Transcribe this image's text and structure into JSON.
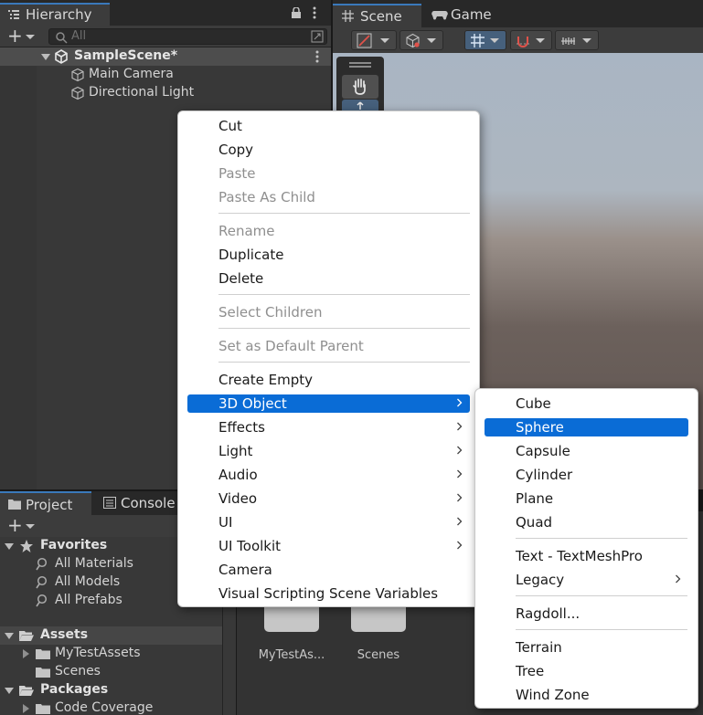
{
  "hierarchy": {
    "tab_label": "Hierarchy",
    "search_placeholder": "All",
    "scene_name": "SampleScene*",
    "objects": [
      "Main Camera",
      "Directional Light"
    ]
  },
  "scene_view": {
    "tabs": [
      {
        "label": "Scene",
        "icon": "grid-hash-icon"
      },
      {
        "label": "Game",
        "icon": "gamepad-icon"
      }
    ]
  },
  "project": {
    "tabs": [
      {
        "label": "Project",
        "icon": "folder-icon"
      },
      {
        "label": "Console",
        "icon": "console-icon"
      }
    ],
    "favorites": {
      "label": "Favorites",
      "items": [
        "All Materials",
        "All Models",
        "All Prefabs"
      ]
    },
    "assets": {
      "label": "Assets",
      "items": [
        "MyTestAssets",
        "Scenes"
      ]
    },
    "packages": {
      "label": "Packages",
      "items": [
        "Code Coverage"
      ]
    },
    "grid_items": [
      "MyTestAs...",
      "Scenes"
    ]
  },
  "context_menu": {
    "items": {
      "cut": "Cut",
      "copy": "Copy",
      "paste": "Paste",
      "paste_as_child": "Paste As Child",
      "rename": "Rename",
      "duplicate": "Duplicate",
      "delete": "Delete",
      "select_children": "Select Children",
      "set_default_parent": "Set as Default Parent",
      "create_empty": "Create Empty",
      "object_3d": "3D Object",
      "effects": "Effects",
      "light": "Light",
      "audio": "Audio",
      "video": "Video",
      "ui": "UI",
      "ui_toolkit": "UI Toolkit",
      "camera": "Camera",
      "visual_scripting": "Visual Scripting Scene Variables"
    }
  },
  "submenu_3d": {
    "items": {
      "cube": "Cube",
      "sphere": "Sphere",
      "capsule": "Capsule",
      "cylinder": "Cylinder",
      "plane": "Plane",
      "quad": "Quad",
      "text_tmp": "Text - TextMeshPro",
      "legacy": "Legacy",
      "ragdoll": "Ragdoll...",
      "terrain": "Terrain",
      "tree": "Tree",
      "wind_zone": "Wind Zone"
    }
  },
  "colors": {
    "highlight": "#0a6cd6",
    "panel_bg": "#383838",
    "tab_accent": "#3a79bb"
  }
}
